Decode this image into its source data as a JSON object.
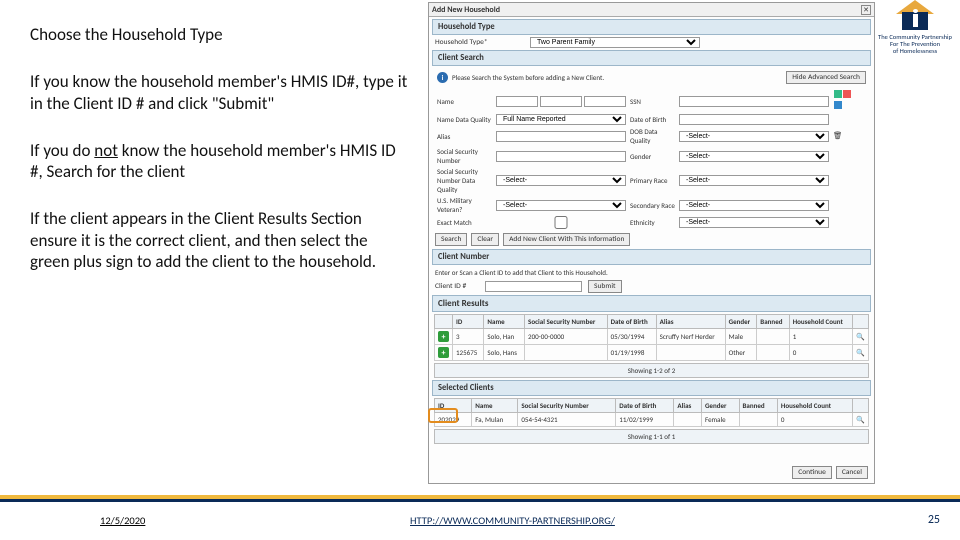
{
  "left": {
    "h1": "Choose the Household Type",
    "p2a": "If you know the household member's HMIS ID#, type it in the Client ID # and click \"Submit\"",
    "p3a": "If you do ",
    "p3u": "not",
    "p3b": " know the household member's HMIS ID #, Search for the client",
    "p4": "If the client appears in the Client Results Section ensure it is the correct client, and then select the green plus sign to add the client to the household."
  },
  "app": {
    "title": "Add New Household",
    "hh_type_hdr": "Household Type",
    "hh_type_lbl": "Household Type*",
    "hh_type_val": "Two Parent Family",
    "cs_hdr": "Client Search",
    "info": "Please Search the System before adding a New Client.",
    "note": "Hide Advanced Search",
    "labels": {
      "name": "Name",
      "ssn": "Social Security Number",
      "ndq": "Name Data Quality",
      "alias": "Alias",
      "ssndq": "Social Security Number Data Quality",
      "usmil": "U.S. Military Veteran?",
      "exact": "Exact Match",
      "dob": "Date of Birth",
      "dobdq": "DOB Data Quality",
      "gender": "Gender",
      "race": "Primary Race",
      "secrace": "Secondary Race",
      "eth": "Ethnicity"
    },
    "ndq_val": "Full Name Reported",
    "sel": "-Select-",
    "btn_search": "Search",
    "btn_clear": "Clear",
    "btn_addnew": "Add New Client With This Information",
    "cn_hdr": "Client Number",
    "cn_note": "Enter or Scan a Client ID to add that Client to this Household.",
    "cn_lbl": "Client ID #",
    "btn_submit": "Submit",
    "cr_hdr": "Client Results",
    "cols": {
      "id": "ID",
      "name": "Name",
      "ssn": "Social Security Number",
      "dob": "Date of Birth",
      "alias": "Alias",
      "gender": "Gender",
      "banned": "Banned",
      "hc": "Household Count"
    },
    "rows": [
      {
        "id": "3",
        "name": "Solo, Han",
        "ssn": "200-00-0000",
        "dob": "05/30/1994",
        "alias": "Scruffy Nerf Herder",
        "gender": "Male",
        "banned": "",
        "hc": "1"
      },
      {
        "id": "125675",
        "name": "Solo, Hans",
        "ssn": "",
        "dob": "01/19/1998",
        "alias": "",
        "gender": "Other",
        "banned": "",
        "hc": "0"
      }
    ],
    "showing": "Showing 1-2 of 2",
    "sel_hdr": "Selected Clients",
    "sel_row": {
      "id": "202029",
      "name": "Fa, Mulan",
      "ssn": "054-54-4321",
      "dob": "11/02/1999",
      "alias": "",
      "gender": "Female",
      "hc": "0"
    },
    "showing2": "Showing 1-1 of 1",
    "btn_continue": "Continue",
    "btn_cancel": "Cancel"
  },
  "footer": {
    "date": "12/5/2020",
    "link": "HTTP://WWW.COMMUNITY-PARTNERSHIP.ORG/",
    "page": "25"
  },
  "logo": {
    "line1": "The Community Partnership",
    "line2": "For The Prevention",
    "line3": "of Homelessness"
  }
}
